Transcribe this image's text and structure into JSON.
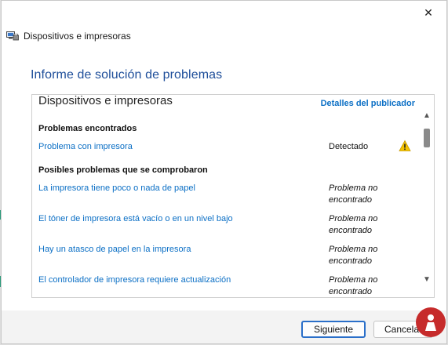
{
  "window": {
    "close_glyph": "✕",
    "title": "Dispositivos e impresoras",
    "app_icon": "devices-printers-icon"
  },
  "heading": "Informe de solución de problemas",
  "report": {
    "title": "Dispositivos e impresoras",
    "publisher_link": "Detalles del publicador",
    "sections": {
      "found_header": "Problemas encontrados",
      "checked_header": "Posibles problemas que se comprobaron"
    },
    "found": [
      {
        "label": "Problema con impresora",
        "status": "Detectado",
        "icon": "warning-icon"
      }
    ],
    "checked": [
      {
        "label": "La impresora tiene poco o nada de papel",
        "status_line1": "Problema no",
        "status_line2": "encontrado"
      },
      {
        "label": "El tóner de impresora está vacío o en un nivel bajo",
        "status_line1": "Problema no",
        "status_line2": "encontrado"
      },
      {
        "label": "Hay un atasco de papel en la impresora",
        "status_line1": "Problema no",
        "status_line2": "encontrado"
      },
      {
        "label": "El controlador de impresora requiere actualización",
        "status_line1": "Problema no",
        "status_line2": "encontrado"
      }
    ]
  },
  "scrollbar": {
    "up_glyph": "▲",
    "down_glyph": "▼"
  },
  "buttons": {
    "next": "Siguiente",
    "cancel": "Cancelar"
  },
  "colors": {
    "heading": "#1e4e9a",
    "link": "#0b6fc5",
    "warning": "#f5c400",
    "primary_border": "#2a6fc9"
  }
}
